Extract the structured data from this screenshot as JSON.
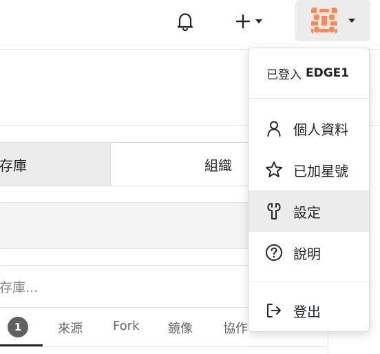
{
  "background": {
    "tabs": [
      "存庫",
      "組織"
    ],
    "search_placeholder": "存庫...",
    "subtabs": {
      "badge": "1",
      "items": [
        "來源",
        "Fork",
        "鏡像",
        "協作"
      ]
    }
  },
  "menu": {
    "signed_in_prefix": "已登入",
    "username": "EDGE1",
    "items": [
      {
        "label": "個人資料",
        "icon": "person-icon"
      },
      {
        "label": "已加星號",
        "icon": "star-icon"
      },
      {
        "label": "設定",
        "icon": "tools-icon"
      },
      {
        "label": "說明",
        "icon": "question-icon"
      }
    ],
    "signout": {
      "label": "登出",
      "icon": "sign-out-icon"
    }
  },
  "colors": {
    "avatar_orange": "#ef8b62",
    "active_bg": "#ececec"
  }
}
